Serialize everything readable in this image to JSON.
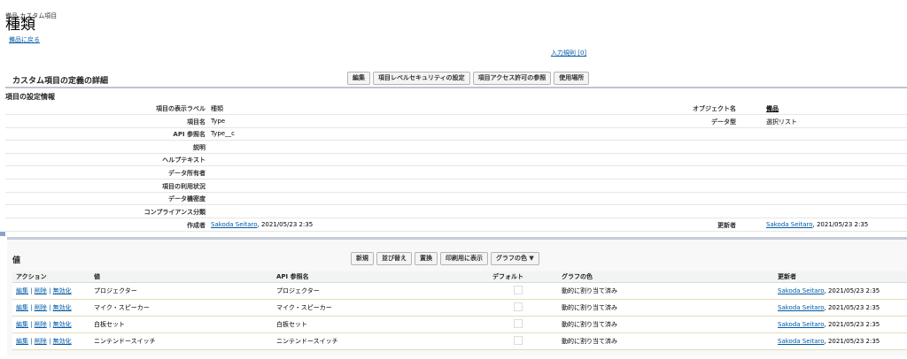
{
  "header": {
    "breadcrumb": "備品 カスタム項目",
    "title": "種類",
    "back_link": "備品に戻る",
    "rules_link": "入力規則 [0]"
  },
  "detail": {
    "section_title": "カスタム項目の定義の詳細",
    "buttons": [
      "編集",
      "項目レベルセキュリティの設定",
      "項目アクセス許可の参照",
      "使用場所"
    ],
    "subheader": "項目の設定情報",
    "rows": [
      {
        "label": "項目の表示ラベル",
        "value": "種類",
        "label2": "オブジェクト名",
        "value2": "備品"
      },
      {
        "label": "項目名",
        "value": "Type",
        "label2": "データ型",
        "value2": "選択リスト"
      },
      {
        "label": "API 参照名",
        "value": "Type__c",
        "label2": "",
        "value2": ""
      },
      {
        "label": "説明",
        "value": "",
        "label2": "",
        "value2": ""
      },
      {
        "label": "ヘルプテキスト",
        "value": "",
        "label2": "",
        "value2": ""
      },
      {
        "label": "データ所有者",
        "value": "",
        "label2": "",
        "value2": ""
      },
      {
        "label": "項目の利用状況",
        "value": "",
        "label2": "",
        "value2": ""
      },
      {
        "label": "データ機密度",
        "value": "",
        "label2": "",
        "value2": ""
      },
      {
        "label": "コンプライアンス分類",
        "value": "",
        "label2": "",
        "value2": ""
      }
    ],
    "created": {
      "label": "作成者",
      "user": "Sakoda Seitaro",
      "date": ", 2021/05/23 2:35"
    },
    "modified": {
      "label": "更新者",
      "user": "Sakoda Seitaro",
      "date": ", 2021/05/23 2:35"
    }
  },
  "values": {
    "section_title": "値",
    "buttons": [
      "新規",
      "並び替え",
      "置換",
      "印刷用に表示",
      "グラフの色 ▼"
    ],
    "columns": [
      "アクション",
      "値",
      "API 参照名",
      "デフォルト",
      "グラフの色",
      "更新者"
    ],
    "actions": {
      "edit": "編集",
      "delete": "削除",
      "deactivate": "無効化",
      "sep": "|"
    },
    "rows": [
      {
        "value": "プロジェクター",
        "api": "プロジェクター",
        "color": "動的に割り当て済み",
        "user": "Sakoda Seitaro",
        "date": ", 2021/05/23 2:35"
      },
      {
        "value": "マイク・スピーカー",
        "api": "マイク・スピーカー",
        "color": "動的に割り当て済み",
        "user": "Sakoda Seitaro",
        "date": ", 2021/05/23 2:35"
      },
      {
        "value": "白板セット",
        "api": "白板セット",
        "color": "動的に割り当て済み",
        "user": "Sakoda Seitaro",
        "date": ", 2021/05/23 2:35"
      },
      {
        "value": "ニンテンドースイッチ",
        "api": "ニンテンドースイッチ",
        "color": "動的に割り当て済み",
        "user": "Sakoda Seitaro",
        "date": ", 2021/05/23 2:35"
      }
    ]
  }
}
